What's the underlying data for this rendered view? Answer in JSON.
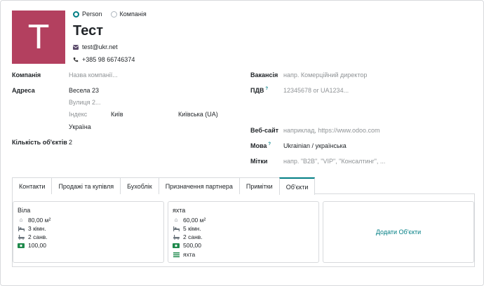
{
  "company_type": {
    "options": [
      "Person",
      "Компанія"
    ],
    "selected": "Person"
  },
  "avatar_letter": "Т",
  "name": "Тест",
  "email": "test@ukr.net",
  "phone": "+385 98 66746374",
  "left_fields": {
    "company": {
      "label": "Компанія",
      "placeholder": "Назва компанії..."
    },
    "address": {
      "label": "Адреса",
      "street": "Весела 23",
      "street2_placeholder": "Вулиця 2...",
      "zip_placeholder": "Індекс",
      "city": "Київ",
      "state": "Київська (UA)",
      "country": "Україна"
    },
    "objects_count": {
      "label": "Кількість об'єктів",
      "value": "2"
    }
  },
  "right_fields": {
    "job": {
      "label": "Вакансія",
      "placeholder": "напр. Комерційний директор"
    },
    "vat": {
      "label": "ПДВ",
      "help": "?",
      "placeholder": "12345678 or UA1234..."
    },
    "website": {
      "label": "Веб-сайт",
      "placeholder": "наприклад, https://www.odoo.com"
    },
    "lang": {
      "label": "Мова",
      "help": "?",
      "value": "Ukrainian / українська"
    },
    "tags": {
      "label": "Мітки",
      "placeholder": "напр. \"B2B\", \"VIP\", \"Консалтинг\", ..."
    }
  },
  "tabs": [
    {
      "label": "Контакти",
      "active": false
    },
    {
      "label": "Продажі та купівля",
      "active": false
    },
    {
      "label": "Бухоблік",
      "active": false
    },
    {
      "label": "Призначення партнера",
      "active": false
    },
    {
      "label": "Примітки",
      "active": false
    },
    {
      "label": "Об'єкти",
      "active": true
    }
  ],
  "objects": [
    {
      "title": "Віла",
      "area": "80,00 м²",
      "rooms": "3 кімн.",
      "baths": "2 санв.",
      "price": "100,00",
      "icons": [
        "home-icon",
        "bed-icon",
        "bath-icon",
        "money-icon"
      ]
    },
    {
      "title": "яхта",
      "area": "60,00 м²",
      "rooms": "5 кімн.",
      "baths": "2 санв.",
      "price": "500,00",
      "type": "яхта",
      "icons": [
        "home-icon",
        "bed-icon",
        "bath-icon",
        "money-icon",
        "list-icon"
      ]
    }
  ],
  "add_objects_label": "Додати Об'єкти",
  "colors": {
    "accent": "#017e84",
    "avatar_bg": "#b3405f",
    "border": "#d8dadd",
    "placeholder": "#8f9396"
  }
}
